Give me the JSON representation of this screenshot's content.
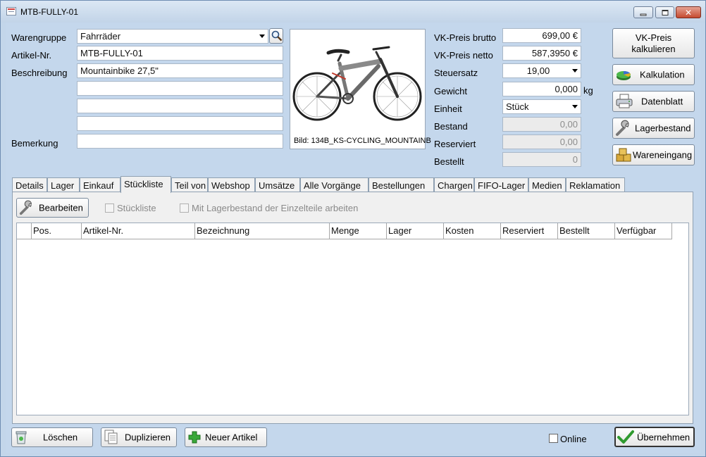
{
  "window": {
    "title": "MTB-FULLY-01"
  },
  "form": {
    "warengruppe_label": "Warengruppe",
    "warengruppe_value": "Fahrräder",
    "artikelnr_label": "Artikel-Nr.",
    "artikelnr_value": "MTB-FULLY-01",
    "beschreibung_label": "Beschreibung",
    "beschreibung_value": "Mountainbike 27,5\"",
    "beschreibung_extra": [
      "",
      "",
      ""
    ],
    "bemerkung_label": "Bemerkung",
    "bemerkung_value": ""
  },
  "image": {
    "caption": "Bild: 134B_KS-CYCLING_MOUNTAINB"
  },
  "pricing": {
    "vk_brutto_label": "VK-Preis brutto",
    "vk_brutto_value": "699,00 €",
    "vk_netto_label": "VK-Preis netto",
    "vk_netto_value": "587,3950 €",
    "steuersatz_label": "Steuersatz",
    "steuersatz_value": "19,00",
    "gewicht_label": "Gewicht",
    "gewicht_value": "0,000",
    "gewicht_unit": "kg",
    "einheit_label": "Einheit",
    "einheit_value": "Stück",
    "bestand_label": "Bestand",
    "bestand_value": "0,00",
    "reserviert_label": "Reserviert",
    "reserviert_value": "0,00",
    "bestellt_label": "Bestellt",
    "bestellt_value": "0"
  },
  "side_buttons": {
    "vk_kalkulieren_line1": "VK-Preis",
    "vk_kalkulieren_line2": "kalkulieren",
    "kalkulation": "Kalkulation",
    "datenblatt": "Datenblatt",
    "lagerbestand": "Lagerbestand",
    "wareneingang": "Wareneingang"
  },
  "tabs": [
    "Details",
    "Lager",
    "Einkauf",
    "Stückliste",
    "Teil von",
    "Webshop",
    "Umsätze",
    "Alle Vorgänge",
    "Bestellungen",
    "Chargen",
    "FIFO-Lager",
    "Medien",
    "Reklamation"
  ],
  "active_tab": "Stückliste",
  "stueckliste": {
    "bearbeiten": "Bearbeiten",
    "cb_stueckliste": "Stückliste",
    "cb_lagerbestand": "Mit Lagerbestand der Einzelteile arbeiten",
    "columns": [
      "Pos.",
      "Artikel-Nr.",
      "Bezeichnung",
      "Menge",
      "Lager",
      "Kosten",
      "Reserviert",
      "Bestellt",
      "Verfügbar"
    ]
  },
  "footer": {
    "loeschen": "Löschen",
    "duplizieren": "Duplizieren",
    "neuer_artikel": "Neuer Artikel",
    "online_label": "Online",
    "uebernehmen": "Übernehmen"
  },
  "colors": {
    "window_bg": "#c4d7ec",
    "panel_bg": "#f0f0f0",
    "ok_check": "#2f9a2f",
    "plus": "#3aa83a"
  }
}
